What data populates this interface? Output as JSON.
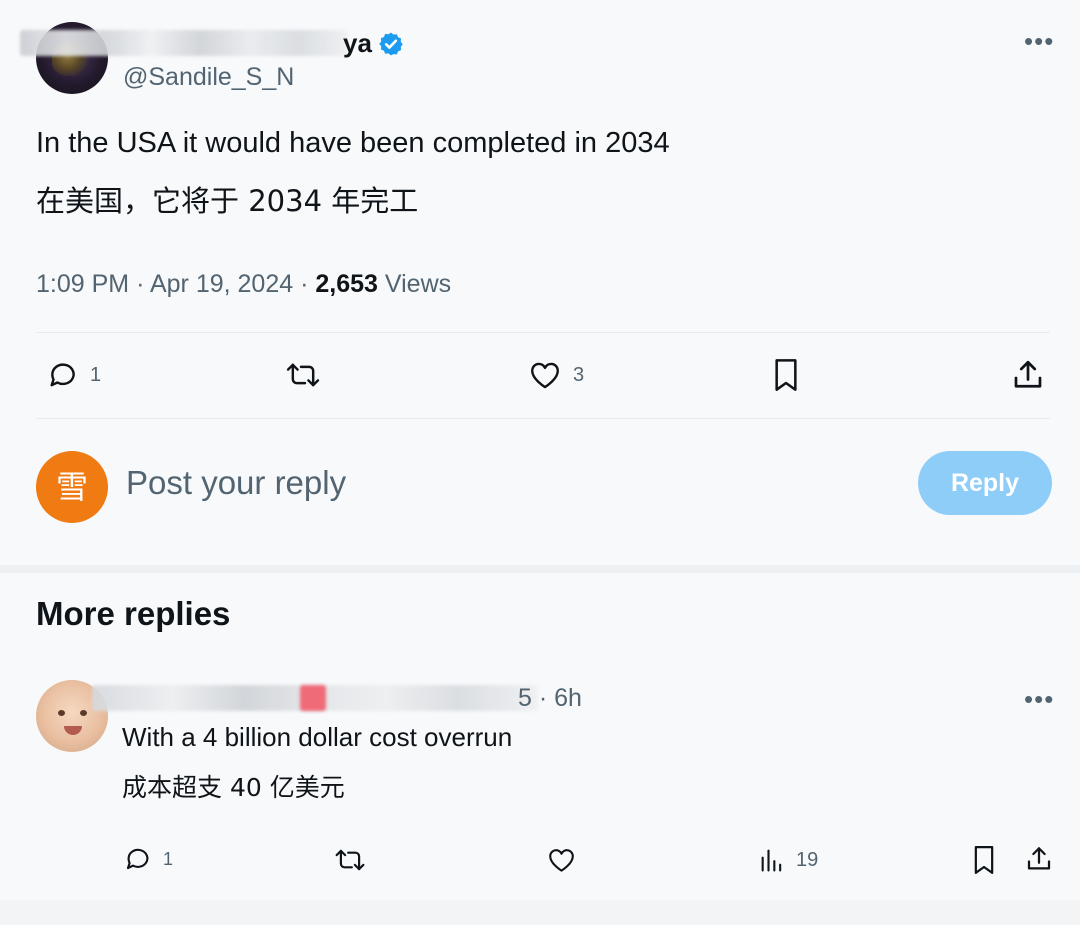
{
  "tweet": {
    "name_visible": "ya",
    "handle": "@Sandile_S_N",
    "text_en": "In the USA it would have been completed in 2034",
    "text_zh": "在美国，它将于 2034 年完工",
    "time": "1:09 PM",
    "date": "Apr 19, 2024",
    "views_count": "2,653",
    "views_label": "Views",
    "more_icon": "more-horizontal-icon",
    "actions": {
      "replies": "1",
      "likes": "3"
    }
  },
  "reply_box": {
    "avatar_char": "雪",
    "avatar_color": "#f07b12",
    "placeholder": "Post your reply",
    "button_label": "Reply",
    "button_color": "#8ecdf8"
  },
  "more_replies": {
    "title": "More replies",
    "items": [
      {
        "time": "5 · 6h",
        "text_en": "With a 4 billion dollar cost overrun",
        "text_zh": "成本超支 40 亿美元",
        "replies": "1",
        "views": "19"
      }
    ]
  },
  "colors": {
    "verified": "#1d9bf0",
    "text_secondary": "#536471"
  }
}
